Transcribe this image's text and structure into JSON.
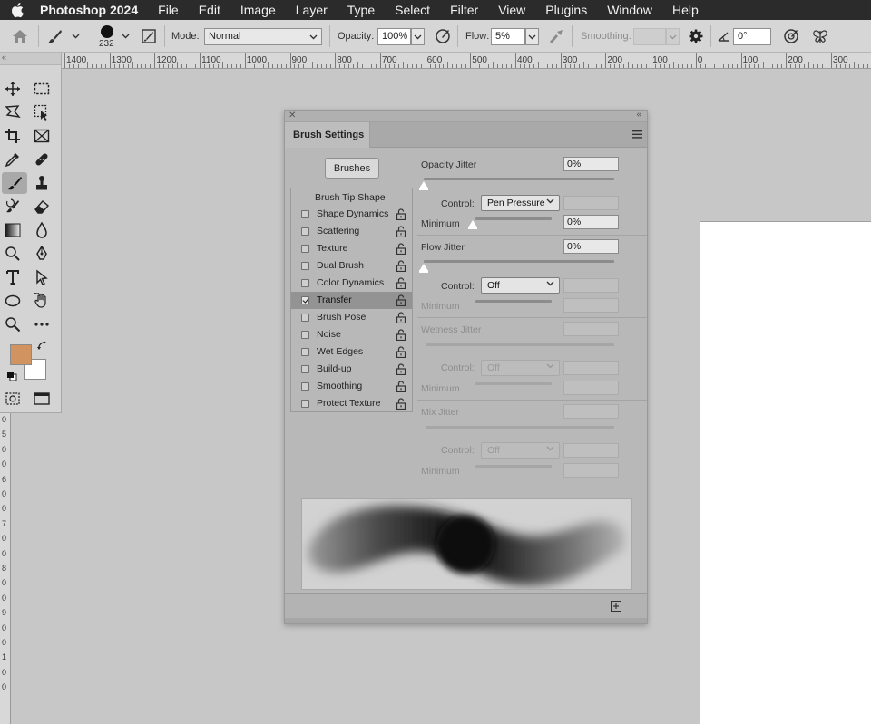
{
  "menubar": {
    "app": "Photoshop 2024",
    "items": [
      "File",
      "Edit",
      "Image",
      "Layer",
      "Type",
      "Select",
      "Filter",
      "View",
      "Plugins",
      "Window",
      "Help"
    ]
  },
  "options_bar": {
    "brush_size": "232",
    "mode_label": "Mode:",
    "mode_value": "Normal",
    "opacity_label": "Opacity:",
    "opacity_value": "100%",
    "flow_label": "Flow:",
    "flow_value": "5%",
    "smoothing_label": "Smoothing:",
    "smoothing_value": "",
    "angle_value": "0°"
  },
  "ruler": {
    "labels": [
      "1400",
      "1300",
      "1200",
      "1100",
      "1000",
      "900",
      "800",
      "700",
      "600",
      "500",
      "400",
      "300",
      "200",
      "100",
      "0",
      "100",
      "200",
      "300"
    ]
  },
  "ruler_v": {
    "labels": [
      "0",
      "5",
      "0",
      "0",
      "6",
      "0",
      "0",
      "7",
      "0",
      "0",
      "8",
      "0",
      "0",
      "9",
      "0",
      "0",
      "1",
      "0",
      "0"
    ]
  },
  "tools": {
    "foreground_color": "#d19460",
    "background_color": "#ffffff"
  },
  "brush_panel": {
    "tab_label": "Brush Settings",
    "brushes_button": "Brushes",
    "head_item": "Brush Tip Shape",
    "items": [
      {
        "label": "Shape Dynamics",
        "checked": false
      },
      {
        "label": "Scattering",
        "checked": false
      },
      {
        "label": "Texture",
        "checked": false
      },
      {
        "label": "Dual Brush",
        "checked": false
      },
      {
        "label": "Color Dynamics",
        "checked": false
      },
      {
        "label": "Transfer",
        "checked": true
      },
      {
        "label": "Brush Pose",
        "checked": false
      },
      {
        "label": "Noise",
        "checked": false
      },
      {
        "label": "Wet Edges",
        "checked": false
      },
      {
        "label": "Build-up",
        "checked": false
      },
      {
        "label": "Smoothing",
        "checked": false
      },
      {
        "label": "Protect Texture",
        "checked": false
      }
    ],
    "opacity_jitter": {
      "label": "Opacity Jitter",
      "value": "0%",
      "control_label": "Control:",
      "control_value": "Pen Pressure",
      "minimum_label": "Minimum",
      "minimum_value": "0%"
    },
    "flow_jitter": {
      "label": "Flow Jitter",
      "value": "0%",
      "control_label": "Control:",
      "control_value": "Off",
      "minimum_label": "Minimum"
    },
    "wetness_jitter": {
      "label": "Wetness Jitter",
      "control_label": "Control:",
      "control_value": "Off",
      "minimum_label": "Minimum"
    },
    "mix_jitter": {
      "label": "Mix Jitter",
      "control_label": "Control:",
      "control_value": "Off",
      "minimum_label": "Minimum"
    }
  }
}
